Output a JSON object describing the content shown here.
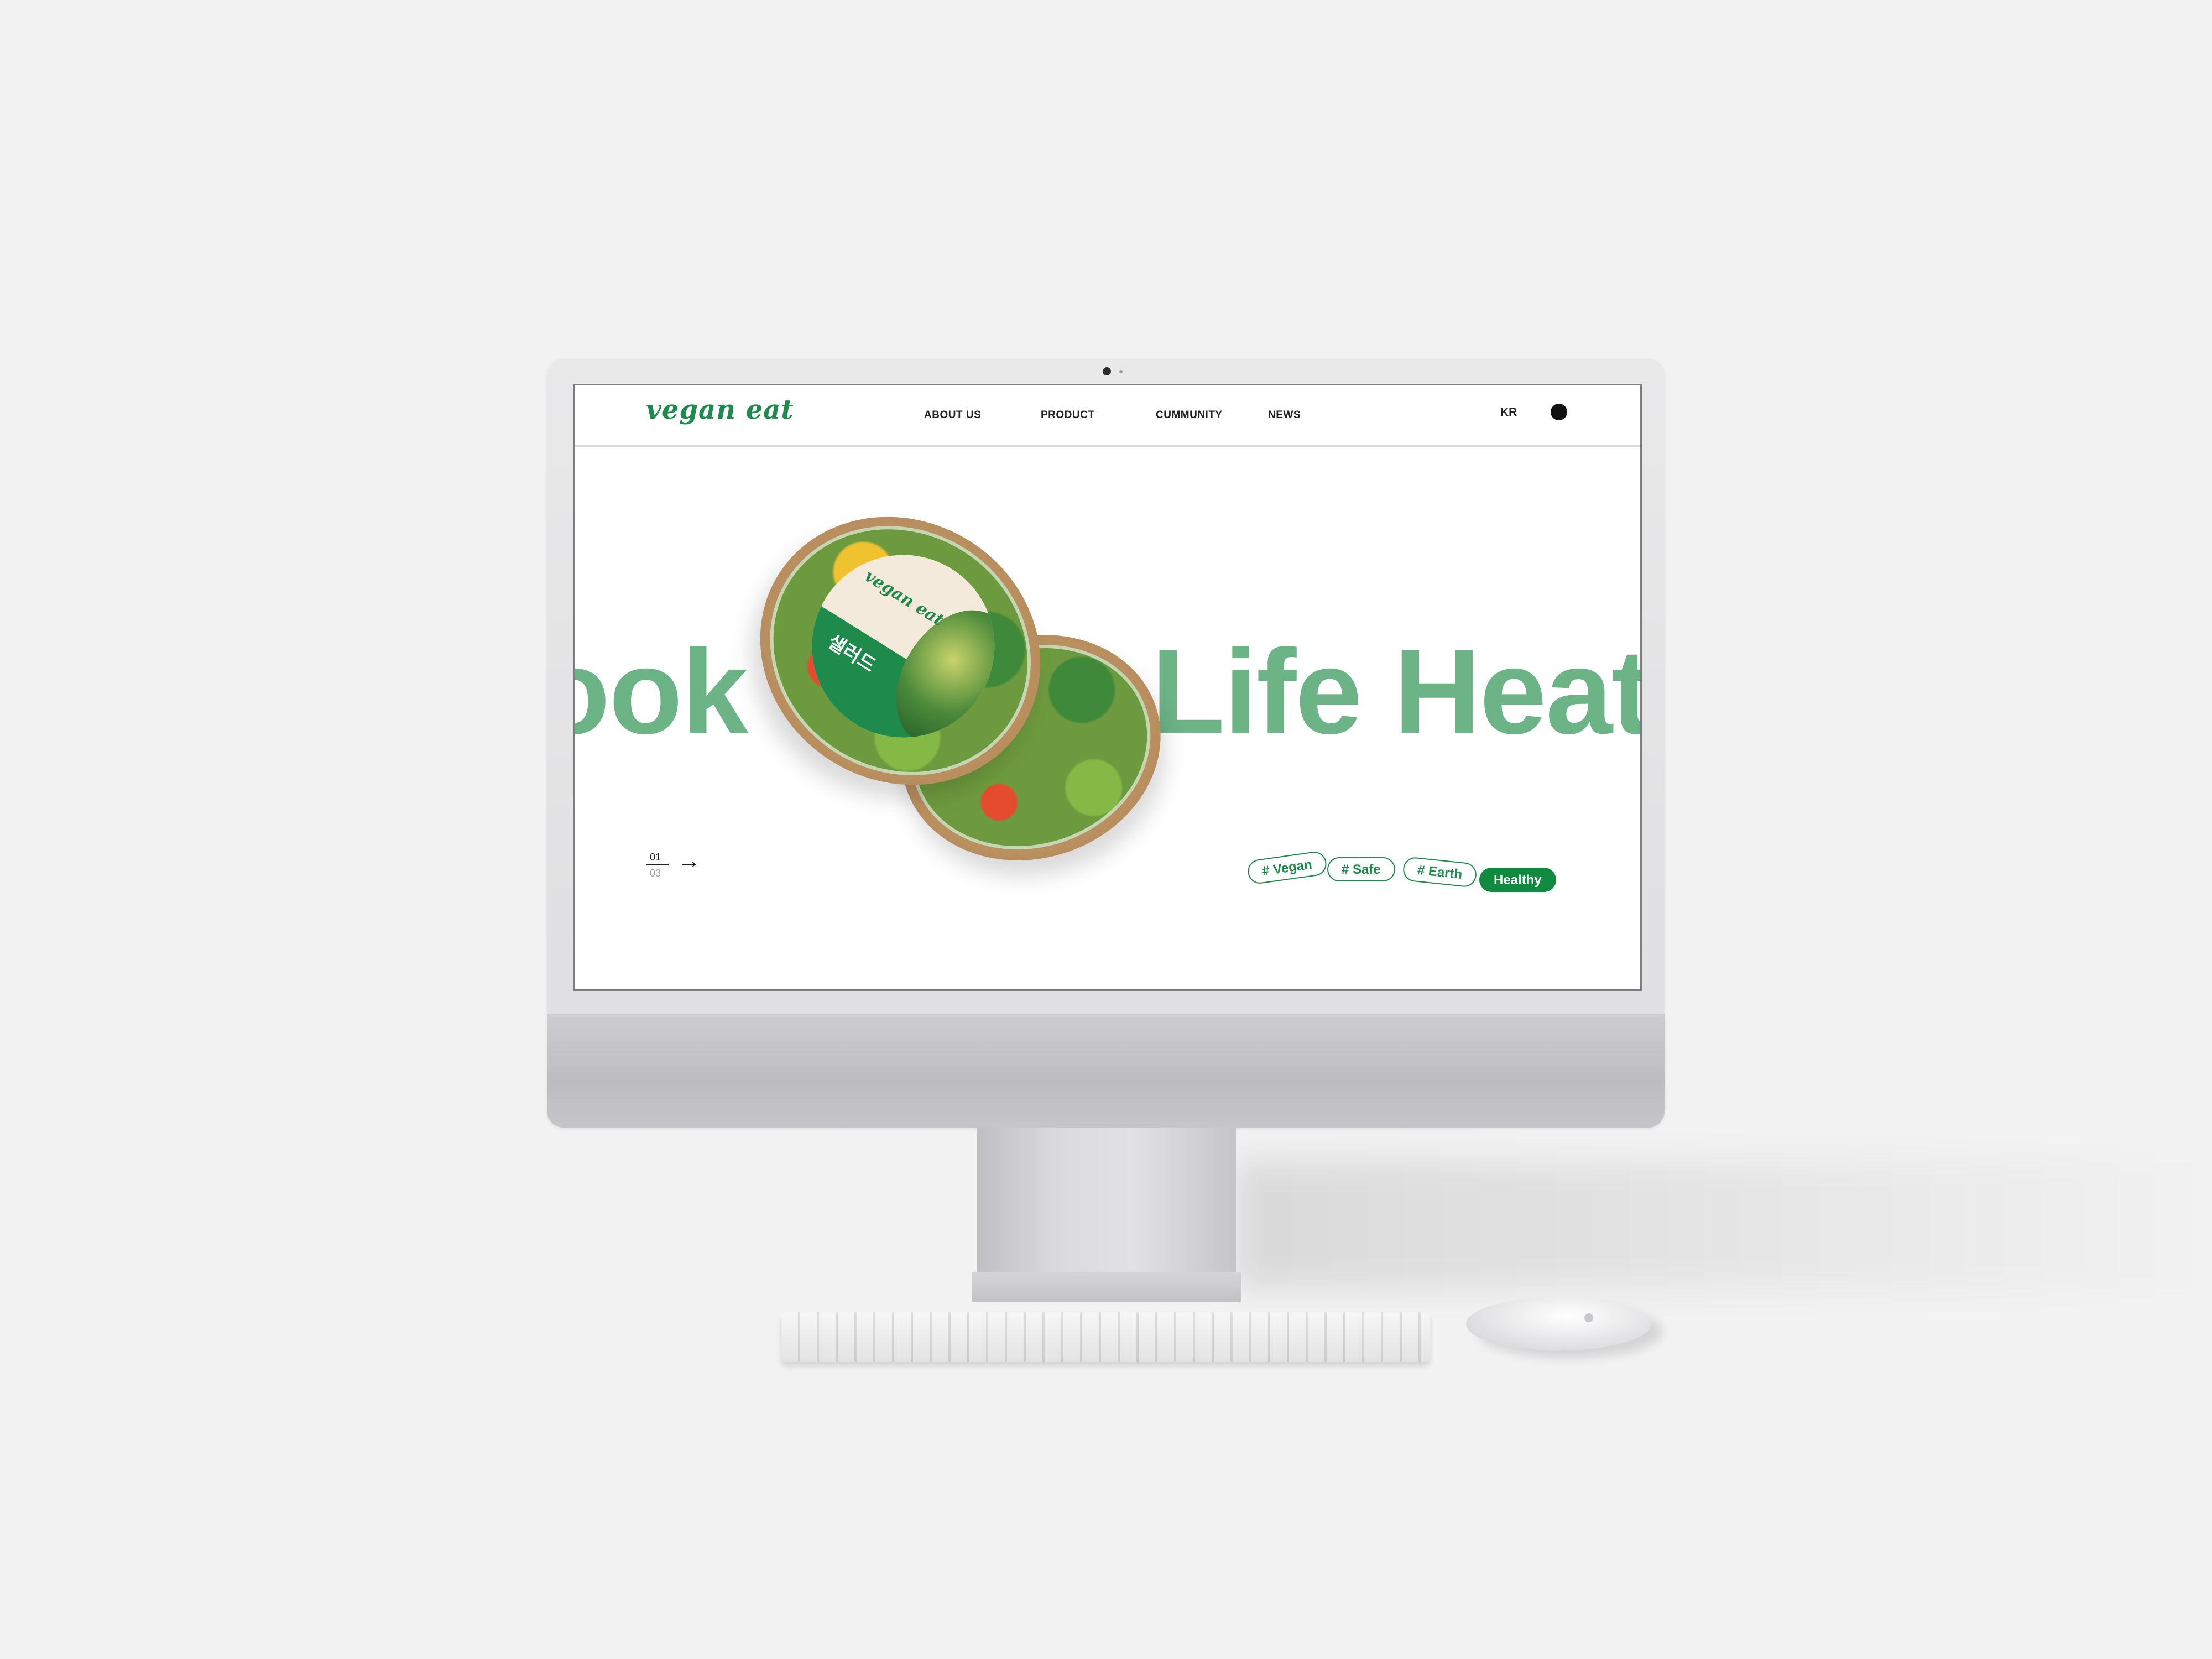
{
  "site": {
    "logo": "vegan eat",
    "nav": [
      "ABOUT US",
      "PRODUCT",
      "CUMMUNITY",
      "NEWS"
    ],
    "language": "KR",
    "hero": {
      "text_left": "ook C",
      "text_right": "Life Heath",
      "product_brand": "vegan eat",
      "product_name": "샐러드"
    },
    "pager": {
      "current": "01",
      "total": "03"
    },
    "tags": [
      {
        "label": "# Vegan",
        "active": false
      },
      {
        "label": "# Safe",
        "active": false
      },
      {
        "label": "# Earth",
        "active": false
      },
      {
        "label": "Healthy",
        "active": true
      }
    ]
  },
  "colors": {
    "brand_green": "#1e8a4c",
    "hero_text_green": "#6cb386",
    "active_tag": "#0f8a3e",
    "background": "#f2f2f2"
  },
  "icons": [
    "camera-icon",
    "menu-dot-icon",
    "arrow-right-icon"
  ]
}
